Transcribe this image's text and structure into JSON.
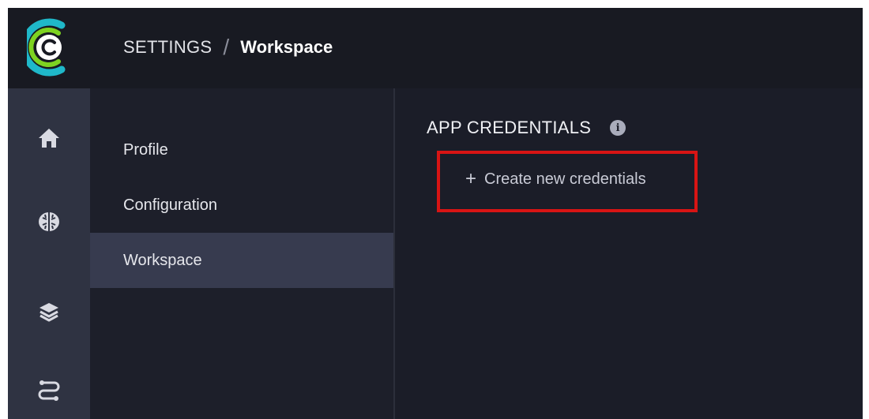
{
  "header": {
    "breadcrumb_root": "SETTINGS",
    "breadcrumb_separator": "/",
    "breadcrumb_current": "Workspace"
  },
  "rail": {
    "icons": [
      "logo-icon",
      "home-icon",
      "brain-icon",
      "layers-icon",
      "workflow-icon"
    ]
  },
  "submenu": {
    "items": [
      {
        "label": "Profile",
        "active": false
      },
      {
        "label": "Configuration",
        "active": false
      },
      {
        "label": "Workspace",
        "active": true
      }
    ]
  },
  "main": {
    "section_title": "APP CREDENTIALS",
    "info_icon_glyph": "i",
    "create_plus": "+",
    "create_label": "Create new credentials"
  },
  "colors": {
    "rail_bg": "#2f3342",
    "header_bg": "#181a22",
    "panel_bg": "#1d1f2a",
    "active_item_bg": "#373b4f",
    "highlight_border": "#d81414",
    "logo_teal": "#1fb8c9",
    "logo_green": "#7ed321"
  }
}
